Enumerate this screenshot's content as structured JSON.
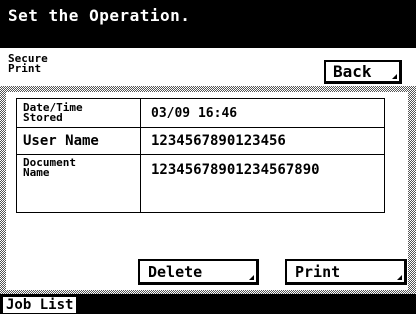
{
  "header": {
    "title": "Set the Operation."
  },
  "subheader": {
    "label_line1": "Secure",
    "label_line2": "Print"
  },
  "toolbar": {
    "back_label": "Back"
  },
  "info_table": {
    "rows": [
      {
        "label_line1": "Date/Time",
        "label_line2": "Stored",
        "value": "03/09  16:46"
      },
      {
        "label_line1": "User Name",
        "label_line2": "",
        "value": "1234567890123456"
      },
      {
        "label_line1": "Document",
        "label_line2": "Name",
        "value": "12345678901234567890"
      }
    ]
  },
  "actions": {
    "delete_label": "Delete",
    "print_label": "Print"
  },
  "footer": {
    "job_list_label": "Job List"
  },
  "colors": {
    "background": "#ffffff",
    "header_bg": "#000000",
    "text": "#000000"
  }
}
